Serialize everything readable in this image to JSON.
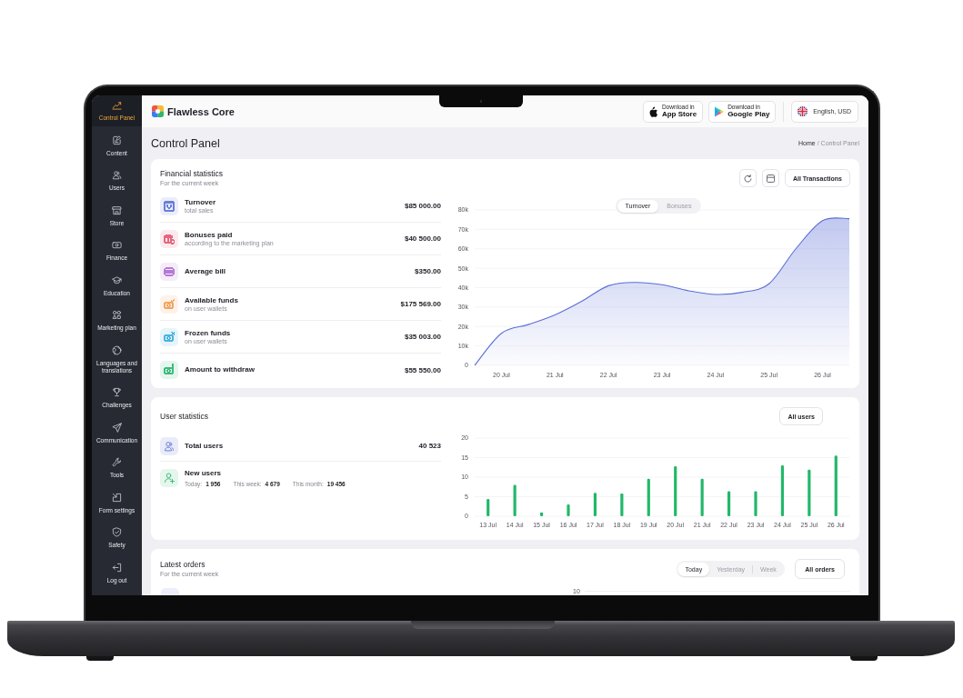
{
  "sidebar": {
    "items": [
      {
        "label": "Control Panel",
        "selected": true
      },
      {
        "label": "Content",
        "selected": false
      },
      {
        "label": "Users",
        "selected": false
      },
      {
        "label": "Store",
        "selected": false
      },
      {
        "label": "Finance",
        "selected": false
      },
      {
        "label": "Education",
        "selected": false
      },
      {
        "label": "Marketing plan",
        "selected": false
      },
      {
        "label": "Languages and translations",
        "selected": false
      },
      {
        "label": "Challenges",
        "selected": false
      },
      {
        "label": "Communication",
        "selected": false
      },
      {
        "label": "Tools",
        "selected": false
      },
      {
        "label": "Form settings",
        "selected": false
      },
      {
        "label": "Safety",
        "selected": false
      },
      {
        "label": "Log out",
        "selected": false
      }
    ]
  },
  "header": {
    "brand": "Flawless Core",
    "store_buttons": [
      {
        "kind": "apple",
        "caption": "Download in",
        "label": "App Store"
      },
      {
        "kind": "google",
        "caption": "Download in",
        "label": "Google Play"
      }
    ],
    "language": {
      "label": "English, USD"
    }
  },
  "page": {
    "title": "Control Panel",
    "breadcrumb": {
      "separator": "/",
      "items": [
        "Home",
        "Control Panel"
      ]
    }
  },
  "financial_statistics": {
    "title": "Financial statistics",
    "subtitle": "For the current week",
    "items": [
      {
        "title": "Turnover",
        "subtitle": "total sales",
        "value": "$85 000.00",
        "color": "#6c7fd8"
      },
      {
        "title": "Bonuses paid",
        "subtitle": "according to the marketing plan",
        "value": "$40 500.00",
        "color": "#e5677f"
      },
      {
        "title": "Average bill",
        "value": "$350.00",
        "color": "#b57ad6"
      },
      {
        "title": "Available funds",
        "subtitle": "on user wallets",
        "value": "$175 569.00",
        "color": "#f4a462"
      },
      {
        "title": "Frozen funds",
        "subtitle": "on user wallets",
        "value": "$35 003.00",
        "color": "#4cb4e0"
      },
      {
        "title": "Amount to withdraw",
        "value": "$55 550.00",
        "color": "#3dbd7d"
      }
    ],
    "button": "All Transactions",
    "toggle": [
      {
        "label": "Turnover",
        "selected": true
      },
      {
        "label": "Bonuses",
        "selected": false
      }
    ],
    "chart_data": {
      "type": "area",
      "categories": [
        null,
        "20 Jul",
        null,
        "21 Jul",
        null,
        "22 Jul",
        null,
        "23 Jul",
        null,
        "24 Jul",
        null,
        "25 Jul",
        null,
        "26 Jul",
        null
      ],
      "series": [
        {
          "color": "#5b6fd6",
          "values": [
            0,
            16500,
            21000,
            26000,
            33000,
            41000,
            42700,
            41500,
            38400,
            36500,
            37600,
            42000,
            60000,
            74500,
            75500
          ]
        }
      ],
      "ylim": [
        0,
        80000
      ],
      "yticks": [
        {
          "value": 0,
          "label": "0"
        },
        {
          "value": 10000,
          "label": "10k"
        },
        {
          "value": 20000,
          "label": "20k"
        },
        {
          "value": 30000,
          "label": "30k"
        },
        {
          "value": 40000,
          "label": "40k"
        },
        {
          "value": 50000,
          "label": "50k"
        },
        {
          "value": 60000,
          "label": "60k"
        },
        {
          "value": 70000,
          "label": "70k"
        },
        {
          "value": 80000,
          "label": "80k"
        }
      ],
      "grid": true
    }
  },
  "user_statistics": {
    "title": "User statistics",
    "button": "All users",
    "total": {
      "label": "Total users",
      "value": "40 523"
    },
    "new_users": {
      "label": "New users",
      "stats": [
        {
          "label": "Today:",
          "value": "1 956"
        },
        {
          "label": "This week:",
          "value": "4 679"
        },
        {
          "label": "This month:",
          "value": "19 456"
        }
      ]
    },
    "chart_data": {
      "type": "bar",
      "categories": [
        "13 Jul",
        "14 Jul",
        "15 Jul",
        "16 Jul",
        "17 Jul",
        "18 Jul",
        "19 Jul",
        "20 Jul",
        "21 Jul",
        "22 Jul",
        "23 Jul",
        "24 Jul",
        "25 Jul",
        "26 Jul"
      ],
      "series": [
        {
          "color": "#22b86a",
          "values": [
            4.4,
            8,
            1,
            3,
            6,
            5.8,
            9.6,
            12.8,
            9.6,
            6.4,
            6.4,
            13,
            11.9,
            15.5
          ]
        }
      ],
      "ylim": [
        0,
        20
      ],
      "yticks": [
        0,
        5,
        10,
        15,
        20
      ],
      "grid": true
    }
  },
  "latest_orders": {
    "title": "Latest orders",
    "subtitle": "For the current week",
    "toggle": [
      {
        "label": "Today",
        "selected": true
      },
      {
        "label": "Yesterday",
        "selected": false
      },
      {
        "label": "Week",
        "selected": false
      }
    ],
    "button": "All orders",
    "chart_tick": "10"
  }
}
